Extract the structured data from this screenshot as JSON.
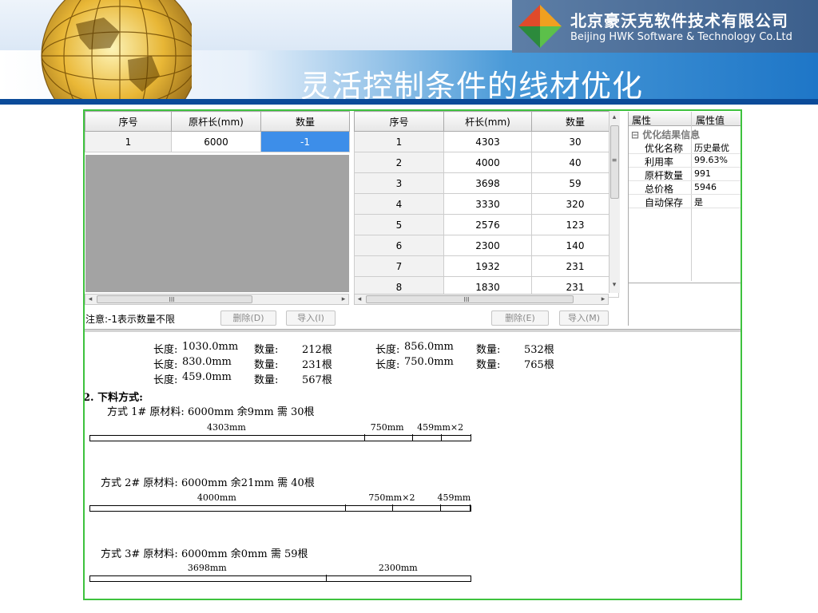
{
  "slide": {
    "title": "灵活控制条件的线材优化",
    "company_cn": "北京豪沃克软件技术有限公司",
    "company_en": "Beijing HWK Software & Technology Co.Ltd",
    "colors": {
      "accent_band": "#1e76c7",
      "dark_rule": "#0b4b99",
      "frame": "#3ec23e",
      "selection": "#3d8ee9",
      "grey_area": "#a3a3a3"
    }
  },
  "stock_table": {
    "headers": [
      "序号",
      "原杆长(mm)",
      "数量"
    ],
    "rows": [
      {
        "no": "1",
        "length": "6000",
        "qty": "-1"
      }
    ]
  },
  "parts_table": {
    "headers": [
      "序号",
      "杆长(mm)",
      "数量"
    ],
    "rows": [
      {
        "no": "1",
        "length": "4303",
        "qty": "30"
      },
      {
        "no": "2",
        "length": "4000",
        "qty": "40"
      },
      {
        "no": "3",
        "length": "3698",
        "qty": "59"
      },
      {
        "no": "4",
        "length": "3330",
        "qty": "320"
      },
      {
        "no": "5",
        "length": "2576",
        "qty": "123"
      },
      {
        "no": "6",
        "length": "2300",
        "qty": "140"
      },
      {
        "no": "7",
        "length": "1932",
        "qty": "231"
      },
      {
        "no": "8",
        "length": "1830",
        "qty": "231"
      }
    ]
  },
  "scroll_glyphs": {
    "left": "◂",
    "right": "▸",
    "up": "▴",
    "down": "▾",
    "grip": "III",
    "grip_v": "≡"
  },
  "note": "注意:-1表示数量不限",
  "buttons": {
    "delete_d": "删除(D)",
    "import_i": "导入(I)",
    "delete_e": "删除(E)",
    "import_m": "导入(M)"
  },
  "properties": {
    "header_key": "属性",
    "header_value": "属性值",
    "group_toggle": "⊟",
    "group": "优化结果信息",
    "items": [
      {
        "key": "优化名称",
        "value": "历史最优"
      },
      {
        "key": "利用率",
        "value": "99.63%"
      },
      {
        "key": "原杆数量",
        "value": "991"
      },
      {
        "key": "总价格",
        "value": "5946"
      },
      {
        "key": "自动保存",
        "value": "是"
      }
    ]
  },
  "report": {
    "summary": [
      {
        "len_label": "长度:",
        "len": "1030.0mm",
        "qty_label": "数量:",
        "qty": "212根"
      },
      {
        "len_label": "长度:",
        "len": "856.0mm",
        "qty_label": "数量:",
        "qty": "532根"
      },
      {
        "len_label": "长度:",
        "len": "830.0mm",
        "qty_label": "数量:",
        "qty": "231根"
      },
      {
        "len_label": "长度:",
        "len": "750.0mm",
        "qty_label": "数量:",
        "qty": "765根"
      },
      {
        "len_label": "长度:",
        "len": "459.0mm",
        "qty_label": "数量:",
        "qty": "567根"
      }
    ],
    "section_heading": "2. 下料方式:",
    "patterns": [
      {
        "label": "方式  1#  原材料: 6000mm 余9mm 需 30根",
        "pieces": [
          4303,
          750,
          459,
          459,
          9
        ],
        "labels": [
          {
            "text": "4303mm"
          },
          {
            "text": "750mm"
          },
          {
            "text": "459mm×2"
          }
        ]
      },
      {
        "label": "方式  2#  原材料: 6000mm 余21mm 需 40根",
        "pieces": [
          4000,
          750,
          750,
          459,
          21
        ],
        "labels": [
          {
            "text": "4000mm"
          },
          {
            "text": "750mm×2"
          },
          {
            "text": "459mm"
          }
        ]
      },
      {
        "label": "方式  3#  原材料: 6000mm 余0mm 需 59根",
        "pieces": [
          3698,
          2302
        ],
        "labels": [
          {
            "text": "3698mm"
          },
          {
            "text": "2300mm"
          }
        ]
      }
    ]
  }
}
